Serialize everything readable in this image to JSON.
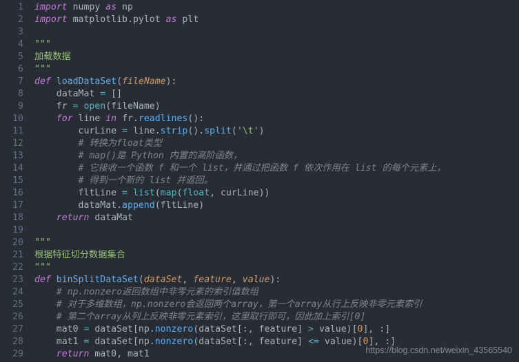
{
  "watermark": "https://blog.csdn.net/weixin_43565540",
  "gutter": {
    "start": 1,
    "end": 29
  },
  "lines": {
    "l1": [
      [
        "kw",
        "import"
      ],
      [
        "nm",
        " numpy "
      ],
      [
        "kw",
        "as"
      ],
      [
        "nm",
        " np"
      ]
    ],
    "l2": [
      [
        "kw",
        "import"
      ],
      [
        "nm",
        " matplotlib"
      ],
      [
        "pn",
        "."
      ],
      [
        "nm",
        "pylot "
      ],
      [
        "kw",
        "as"
      ],
      [
        "nm",
        " plt"
      ]
    ],
    "l3": [
      [
        "nm",
        ""
      ]
    ],
    "l4": [
      [
        "str",
        "\"\"\""
      ]
    ],
    "l5": [
      [
        "str",
        "加载数据"
      ]
    ],
    "l6": [
      [
        "str",
        "\"\"\""
      ]
    ],
    "l7": [
      [
        "kw",
        "def"
      ],
      [
        "nm",
        " "
      ],
      [
        "fn",
        "loadDataSet"
      ],
      [
        "pn",
        "("
      ],
      [
        "prm",
        "fileName"
      ],
      [
        "pn",
        "):"
      ]
    ],
    "l8": [
      [
        "nm",
        "    dataMat "
      ],
      [
        "op",
        "="
      ],
      [
        "nm",
        " []"
      ]
    ],
    "l9": [
      [
        "nm",
        "    fr "
      ],
      [
        "op",
        "="
      ],
      [
        "nm",
        " "
      ],
      [
        "builtin",
        "open"
      ],
      [
        "pn",
        "("
      ],
      [
        "nm",
        "fileName"
      ],
      [
        "pn",
        ")"
      ]
    ],
    "l10": [
      [
        "nm",
        "    "
      ],
      [
        "kw",
        "for"
      ],
      [
        "nm",
        " line "
      ],
      [
        "kw",
        "in"
      ],
      [
        "nm",
        " fr"
      ],
      [
        "pn",
        "."
      ],
      [
        "fn",
        "readlines"
      ],
      [
        "pn",
        "():"
      ]
    ],
    "l11": [
      [
        "nm",
        "        curLine "
      ],
      [
        "op",
        "="
      ],
      [
        "nm",
        " line"
      ],
      [
        "pn",
        "."
      ],
      [
        "fn",
        "strip"
      ],
      [
        "pn",
        "()."
      ],
      [
        "fn",
        "split"
      ],
      [
        "pn",
        "("
      ],
      [
        "str",
        "'\\t'"
      ],
      [
        "pn",
        ")"
      ]
    ],
    "l12": [
      [
        "nm",
        "        "
      ],
      [
        "cmt",
        "# 转换为float类型"
      ]
    ],
    "l13": [
      [
        "nm",
        "        "
      ],
      [
        "cmt",
        "# map()是 Python 内置的高阶函数，"
      ]
    ],
    "l14": [
      [
        "nm",
        "        "
      ],
      [
        "cmt",
        "# 它接收一个函数 f 和一个 list，并通过把函数 f 依次作用在 list 的每个元素上，"
      ]
    ],
    "l15": [
      [
        "nm",
        "        "
      ],
      [
        "cmt",
        "# 得到一个新的 list 并返回。"
      ]
    ],
    "l16": [
      [
        "nm",
        "        fltLine "
      ],
      [
        "op",
        "="
      ],
      [
        "nm",
        " "
      ],
      [
        "builtin",
        "list"
      ],
      [
        "pn",
        "("
      ],
      [
        "builtin",
        "map"
      ],
      [
        "pn",
        "("
      ],
      [
        "builtin",
        "float"
      ],
      [
        "pn",
        ", curLine))"
      ]
    ],
    "l17": [
      [
        "nm",
        "        dataMat"
      ],
      [
        "pn",
        "."
      ],
      [
        "fn",
        "append"
      ],
      [
        "pn",
        "("
      ],
      [
        "nm",
        "fltLine"
      ],
      [
        "pn",
        ")"
      ]
    ],
    "l18": [
      [
        "nm",
        "    "
      ],
      [
        "kw",
        "return"
      ],
      [
        "nm",
        " dataMat"
      ]
    ],
    "l19": [
      [
        "nm",
        ""
      ]
    ],
    "l20": [
      [
        "str",
        "\"\"\""
      ]
    ],
    "l21": [
      [
        "str",
        "根据特征切分数据集合"
      ]
    ],
    "l22": [
      [
        "str",
        "\"\"\""
      ]
    ],
    "l23": [
      [
        "kw",
        "def"
      ],
      [
        "nm",
        " "
      ],
      [
        "fn",
        "binSplitDataSet"
      ],
      [
        "pn",
        "("
      ],
      [
        "prm",
        "dataSet"
      ],
      [
        "pn",
        ", "
      ],
      [
        "prm",
        "feature"
      ],
      [
        "pn",
        ", "
      ],
      [
        "prm",
        "value"
      ],
      [
        "pn",
        "):"
      ]
    ],
    "l24": [
      [
        "nm",
        "    "
      ],
      [
        "cmt",
        "# np.nonzero返回数组中非零元素的索引值数组"
      ]
    ],
    "l25": [
      [
        "nm",
        "    "
      ],
      [
        "cmt",
        "# 对于多维数组，np.nonzero会返回两个array，第一个array从行上反映非零元素索引"
      ]
    ],
    "l26": [
      [
        "nm",
        "    "
      ],
      [
        "cmt",
        "# 第二个array从列上反映非零元素索引，这里取行即可，因此加上索引[0]"
      ]
    ],
    "l27": [
      [
        "nm",
        "    mat0 "
      ],
      [
        "op",
        "="
      ],
      [
        "nm",
        " dataSet[np"
      ],
      [
        "pn",
        "."
      ],
      [
        "fn",
        "nonzero"
      ],
      [
        "pn",
        "("
      ],
      [
        "nm",
        "dataSet[:, feature] "
      ],
      [
        "op",
        ">"
      ],
      [
        "nm",
        " value"
      ],
      [
        "pn",
        ")["
      ],
      [
        "num",
        "0"
      ],
      [
        "pn",
        "], :]"
      ]
    ],
    "l28": [
      [
        "nm",
        "    mat1 "
      ],
      [
        "op",
        "="
      ],
      [
        "nm",
        " dataSet[np"
      ],
      [
        "pn",
        "."
      ],
      [
        "fn",
        "nonzero"
      ],
      [
        "pn",
        "("
      ],
      [
        "nm",
        "dataSet[:, feature] "
      ],
      [
        "op",
        "<="
      ],
      [
        "nm",
        " value"
      ],
      [
        "pn",
        ")["
      ],
      [
        "num",
        "0"
      ],
      [
        "pn",
        "], :]"
      ]
    ],
    "l29": [
      [
        "nm",
        "    "
      ],
      [
        "kw",
        "return"
      ],
      [
        "nm",
        " mat0, mat1"
      ]
    ]
  }
}
